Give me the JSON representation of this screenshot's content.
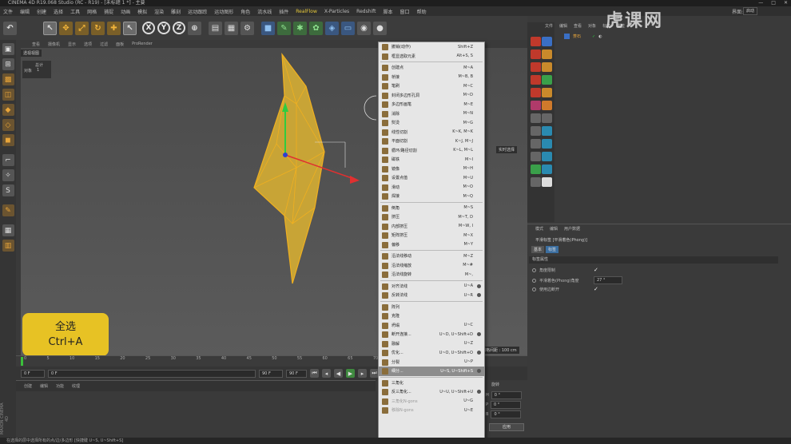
{
  "window": {
    "title": "CINEMA 4D R19.068 Studio (RC - R19) - [未标题 1 *] - 主要",
    "controls": [
      "—",
      "□",
      "✕"
    ]
  },
  "menubar": {
    "items": [
      "文件",
      "编辑",
      "创建",
      "选择",
      "工具",
      "网格",
      "捕捉",
      "动画",
      "模拟",
      "渲染",
      "雕刻",
      "运动跟踪",
      "运动图形",
      "角色",
      "流水线",
      "插件",
      "RealFlow",
      "X-Particles",
      "Redshift",
      "脚本",
      "窗口",
      "帮助"
    ],
    "highlight": "RealFlow",
    "layout_label": "界面:",
    "layout_value": "启动"
  },
  "viewport": {
    "label": "透视视图",
    "menu": [
      "查看",
      "摄像机",
      "显示",
      "选项",
      "过滤",
      "面板",
      "ProRender"
    ],
    "stats": {
      "header": "总计",
      "row_label": "对象",
      "row_value": "1"
    },
    "realtime_label": "实时选择",
    "grid_label": "网格间距 : 100 cm"
  },
  "badge": {
    "line1": "全选",
    "line2": "Ctrl+A"
  },
  "timeline": {
    "ticks": [
      "0",
      "5",
      "10",
      "15",
      "20",
      "25",
      "30",
      "35",
      "40",
      "45",
      "50",
      "55",
      "60",
      "65",
      "70",
      "75",
      "80",
      "85",
      "90"
    ],
    "start": "0 F",
    "start2": "0 F",
    "end": "90 F",
    "end2": "90 F"
  },
  "materials": {
    "menu": [
      "创建",
      "编辑",
      "功能",
      "纹理"
    ]
  },
  "brand": {
    "name": "MAXON CINEMA 4D"
  },
  "coords": {
    "header": "旋转",
    "rows": [
      {
        "axis": "H",
        "value": "0 °"
      },
      {
        "axis": "P",
        "value": "0 °"
      },
      {
        "axis": "B",
        "value": "0 °"
      }
    ],
    "apply_label": "应用"
  },
  "status": {
    "text": "在选择的层中选择所有的点/边/多边形 [快捷键 U~S, U~Shift+S]"
  },
  "context_menu": {
    "items": [
      {
        "label": "撤销(动作)",
        "shortcut": "Shift+Z",
        "type": "item"
      },
      {
        "label": "框显选取元素",
        "shortcut": "Alt+S, S",
        "type": "item"
      },
      {
        "type": "sep"
      },
      {
        "label": "创建点",
        "shortcut": "M~A",
        "type": "item"
      },
      {
        "label": "桥接",
        "shortcut": "M~B, B",
        "type": "item"
      },
      {
        "label": "笔刷",
        "shortcut": "M~C",
        "type": "item"
      },
      {
        "label": "封闭多边形孔洞",
        "shortcut": "M~D",
        "type": "item"
      },
      {
        "label": "多边形画笔",
        "shortcut": "M~E",
        "type": "item"
      },
      {
        "label": "消除",
        "shortcut": "M~N",
        "type": "item"
      },
      {
        "label": "熨烫",
        "shortcut": "M~G",
        "type": "item"
      },
      {
        "label": "线性切割",
        "shortcut": "K~K, M~K",
        "type": "item"
      },
      {
        "label": "平面切割",
        "shortcut": "K~J, M~J",
        "type": "item"
      },
      {
        "label": "循环/路径切割",
        "shortcut": "K~L, M~L",
        "type": "item"
      },
      {
        "label": "磁铁",
        "shortcut": "M~I",
        "type": "item"
      },
      {
        "label": "镜像",
        "shortcut": "M~H",
        "type": "item"
      },
      {
        "label": "设置点值",
        "shortcut": "M~U",
        "type": "item"
      },
      {
        "label": "滑动",
        "shortcut": "M~O",
        "type": "item"
      },
      {
        "label": "焊接",
        "shortcut": "M~Q",
        "type": "item"
      },
      {
        "type": "sep"
      },
      {
        "label": "倒角",
        "shortcut": "M~S",
        "type": "item"
      },
      {
        "label": "挤压",
        "shortcut": "M~T, D",
        "type": "item"
      },
      {
        "label": "内部挤压",
        "shortcut": "M~W, I",
        "type": "item"
      },
      {
        "label": "矩阵挤压",
        "shortcut": "M~X",
        "type": "item"
      },
      {
        "label": "偏移",
        "shortcut": "M~Y",
        "type": "item"
      },
      {
        "type": "sep"
      },
      {
        "label": "沿法线移动",
        "shortcut": "M~Z",
        "type": "item"
      },
      {
        "label": "沿法线缩放",
        "shortcut": "M~#",
        "type": "item"
      },
      {
        "label": "沿法线旋转",
        "shortcut": "M~,",
        "type": "item"
      },
      {
        "type": "sep"
      },
      {
        "label": "对齐法线",
        "shortcut": "U~A",
        "type": "item",
        "dot": true
      },
      {
        "label": "反转法线",
        "shortcut": "U~R",
        "type": "item",
        "dot": true
      },
      {
        "type": "sep"
      },
      {
        "label": "阵列",
        "shortcut": "",
        "type": "item"
      },
      {
        "label": "克隆",
        "shortcut": "",
        "type": "item"
      },
      {
        "label": "坍塌",
        "shortcut": "U~C",
        "type": "item"
      },
      {
        "label": "断开连接...",
        "shortcut": "U~D, U~Shift+D",
        "type": "item",
        "dot": true
      },
      {
        "label": "融解",
        "shortcut": "U~Z",
        "type": "item"
      },
      {
        "label": "优化...",
        "shortcut": "U~O, U~Shift+O",
        "type": "item",
        "dot": true
      },
      {
        "label": "分裂",
        "shortcut": "U~P",
        "type": "item"
      },
      {
        "label": "细分...",
        "shortcut": "U~S, U~Shift+S",
        "type": "item",
        "dot": true,
        "highlight": true
      },
      {
        "type": "sep"
      },
      {
        "label": "三角化",
        "shortcut": "",
        "type": "item"
      },
      {
        "label": "反三角化...",
        "shortcut": "U~U, U~Shift+U",
        "type": "item",
        "dot": true
      },
      {
        "label": "三角化N-gons",
        "shortcut": "U~G",
        "type": "item",
        "disabled": true
      },
      {
        "label": "移除N-gons",
        "shortcut": "U~E",
        "type": "item",
        "disabled": true
      }
    ]
  },
  "objects": {
    "menu": [
      "文件",
      "编辑",
      "查看",
      "对象",
      "标签",
      "书签"
    ],
    "item": "菱石"
  },
  "attributes": {
    "menu": [
      "模式",
      "编辑",
      "用户数据"
    ],
    "title": "平滑标签 [平滑着色(Phong)]",
    "tabs": [
      "基本",
      "标签"
    ],
    "section": "标签属性",
    "rows": [
      {
        "label": "角度限制",
        "value": "✓"
      },
      {
        "label": "平滑着色(Phong)角度",
        "value": "27 °"
      },
      {
        "label": "使用边断开",
        "value": "✓"
      }
    ]
  },
  "watermark": {
    "text": "虎课网"
  }
}
